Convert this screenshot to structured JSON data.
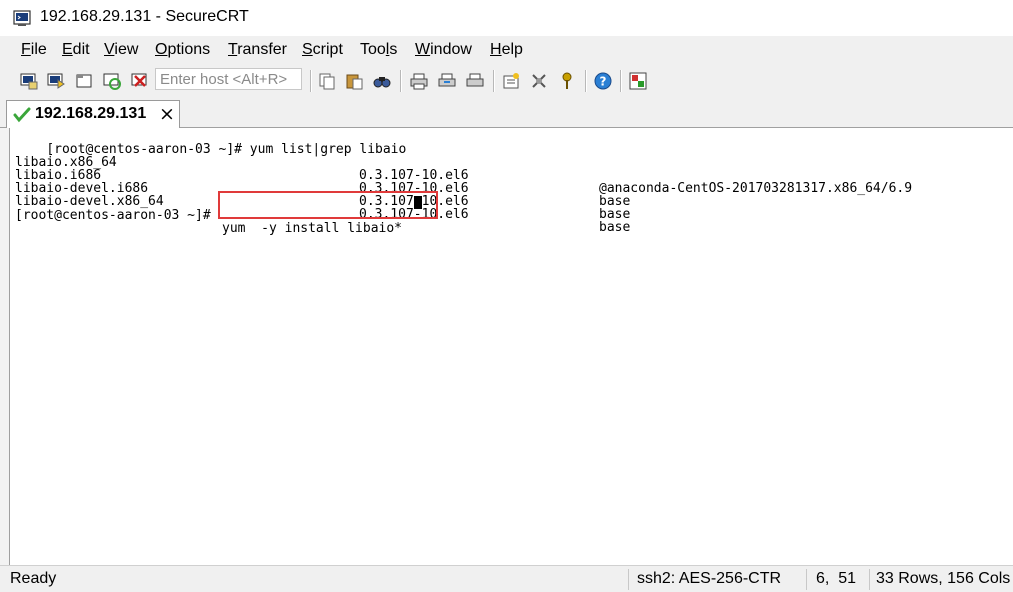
{
  "window": {
    "title": "192.168.29.131 - SecureCRT"
  },
  "menu": [
    {
      "label_ul": "F",
      "label_rest": "ile"
    },
    {
      "label_ul": "E",
      "label_rest": "dit"
    },
    {
      "label_ul": "V",
      "label_rest": "iew"
    },
    {
      "label_ul": "O",
      "label_rest": "ptions"
    },
    {
      "label_ul": "T",
      "label_rest": "ransfer"
    },
    {
      "label_ul": "S",
      "label_rest": "cript"
    },
    {
      "label_pre": "Too",
      "label_ul": "l",
      "label_rest": "s"
    },
    {
      "label_ul": "W",
      "label_rest": "indow"
    },
    {
      "label_ul": "H",
      "label_rest": "elp"
    }
  ],
  "toolbar": {
    "host_placeholder": "Enter host <Alt+R>",
    "icons": [
      "connect-icon",
      "quick-connect-icon",
      "connect-tab-icon",
      "reconnect-icon",
      "disconnect-icon",
      "copy-icon",
      "paste-icon",
      "find-icon",
      "print-icon",
      "print-setup-icon",
      "print-selection-icon",
      "session-options-icon",
      "global-options-icon",
      "keymap-icon",
      "help-icon",
      "sftp-icon"
    ],
    "colors": {
      "accent": "#2a7fd4",
      "disconnect": "#cc2020",
      "key": "#c8a000"
    }
  },
  "tab": {
    "label": "192.168.29.131",
    "close": "×",
    "status_color": "#3aa63a"
  },
  "terminal": {
    "lines": [
      {
        "c1": "[root@centos-aaron-03 ~]# yum list|grep libaio",
        "c2": "",
        "c3": ""
      },
      {
        "c1": "libaio.x86_64",
        "c2": "0.3.107-10.el6",
        "c3": "@anaconda-CentOS-201703281317.x86_64/6.9"
      },
      {
        "c1": "libaio.i686",
        "c2": "0.3.107-10.el6",
        "c3": "base"
      },
      {
        "c1": "libaio-devel.i686",
        "c2": "0.3.107-10.el6",
        "c3": "base"
      },
      {
        "c1": "libaio-devel.x86_64",
        "c2": "0.3.107-10.el6",
        "c3": "base"
      }
    ],
    "prompt": "[root@centos-aaron-03 ~]# ",
    "command": "yum  -y install libaio* ",
    "highlight_color": "#e03a3a"
  },
  "status": {
    "ready": "Ready",
    "cipher": "ssh2: AES-256-CTR",
    "position": "6,  51",
    "size": "33 Rows, 156 Cols"
  }
}
